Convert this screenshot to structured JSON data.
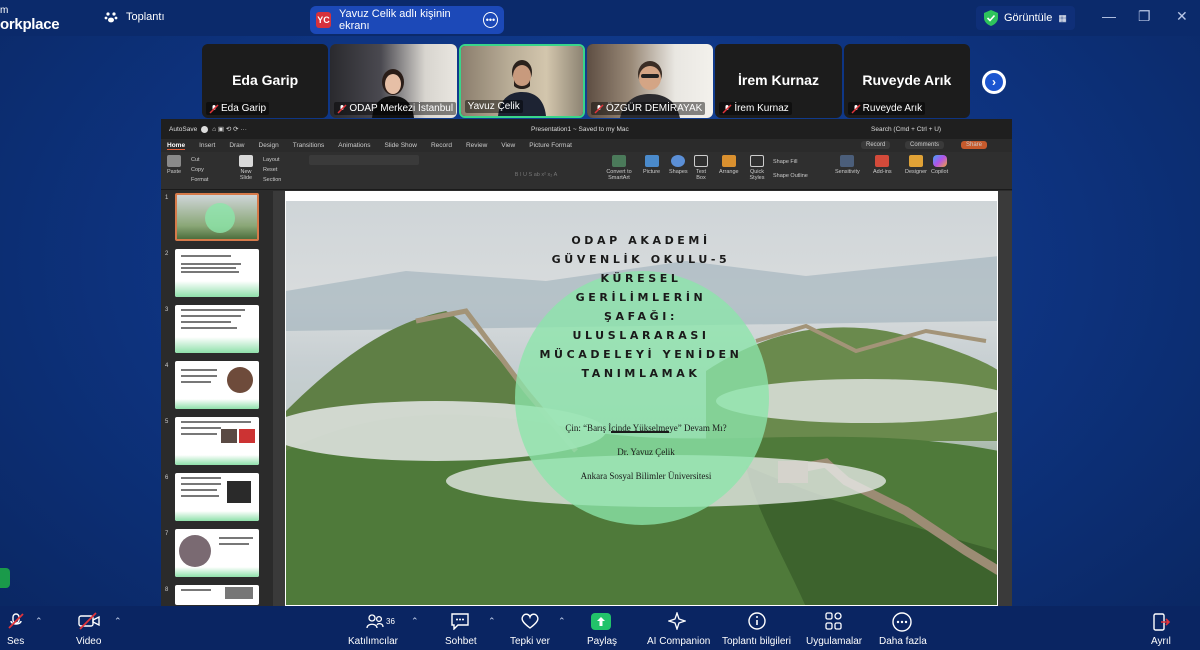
{
  "app": {
    "brand_line1": "m",
    "brand_line2": "orkplace",
    "meeting_tab": "Toplantı",
    "share_tab": "Yavuz Celik adlı kişinin ekranı",
    "share_initials": "YC",
    "view_label": "Görüntüle"
  },
  "participants": [
    {
      "big": "Eda Garip",
      "label": "Eda Garip",
      "video": false
    },
    {
      "big": "",
      "label": "ODAP Merkezi İstanbul",
      "video": true
    },
    {
      "big": "",
      "label": "Yavuz Çelik",
      "video": true
    },
    {
      "big": "",
      "label": "ÖZGÜR DEMİRAYAK",
      "video": true
    },
    {
      "big": "İrem Kurnaz",
      "label": "İrem Kurnaz",
      "video": false
    },
    {
      "big": "Ruveyde Arık",
      "label": "Ruveyde Arık",
      "video": false
    }
  ],
  "ppt": {
    "autosave": "AutoSave",
    "doc_title": "Presentation1 ~ Saved to my Mac",
    "search": "Search (Cmd + Ctrl + U)",
    "tabs": [
      "Home",
      "Insert",
      "Draw",
      "Design",
      "Transitions",
      "Animations",
      "Slide Show",
      "Record",
      "Review",
      "View",
      "Picture Format"
    ],
    "record": "Record",
    "comments": "Comments",
    "share": "Share",
    "ribbon": {
      "paste": "Paste",
      "cut": "Cut",
      "copy": "Copy",
      "format": "Format",
      "new_slide": "New Slide",
      "layout": "Layout",
      "reset": "Reset",
      "section": "Section",
      "convert": "Convert to SmartArt",
      "picture": "Picture",
      "shapes": "Shapes",
      "textbox": "Text Box",
      "arrange": "Arrange",
      "quick_styles": "Quick Styles",
      "shape_fill": "Shape Fill",
      "shape_outline": "Shape Outline",
      "sensitivity": "Sensitivity",
      "addins": "Add-ins",
      "designer": "Designer",
      "copilot": "Copilot"
    },
    "slide_numbers": [
      "1",
      "2",
      "3",
      "4",
      "5",
      "6",
      "7",
      "8"
    ],
    "slide": {
      "title_lines": [
        "ODAP AKADEMİ",
        "GÜVENLİK OKULU-5",
        "KÜRESEL",
        "GERİLİMLERİN",
        "ŞAFAĞI:",
        "ULUSLARARASI",
        "MÜCADELEYİ YENİDEN",
        "TANIMLAMAK"
      ],
      "subtitle": "Çin: “Barış İçinde Yükselmeye” Devam Mı?",
      "author": "Dr. Yavuz Çelik",
      "affiliation": "Ankara Sosyal Bilimler Üniversitesi"
    }
  },
  "toolbar": {
    "items": [
      {
        "label": "Ses",
        "icon": "mic-off-icon"
      },
      {
        "label": "Video",
        "icon": "video-off-icon"
      },
      {
        "label": "Katılımcılar",
        "icon": "participants-icon",
        "count": "36"
      },
      {
        "label": "Sohbet",
        "icon": "chat-icon"
      },
      {
        "label": "Tepki ver",
        "icon": "heart-icon"
      },
      {
        "label": "Paylaş",
        "icon": "share-icon"
      },
      {
        "label": "AI Companion",
        "icon": "sparkle-icon"
      },
      {
        "label": "Toplantı bilgileri",
        "icon": "info-icon"
      },
      {
        "label": "Uygulamalar",
        "icon": "apps-icon"
      },
      {
        "label": "Daha fazla",
        "icon": "more-icon"
      },
      {
        "label": "Ayrıl",
        "icon": "leave-icon"
      }
    ]
  },
  "colors": {
    "accent": "#39d58a",
    "danger": "#d6313c",
    "ppt_orange": "#c65a2c"
  }
}
